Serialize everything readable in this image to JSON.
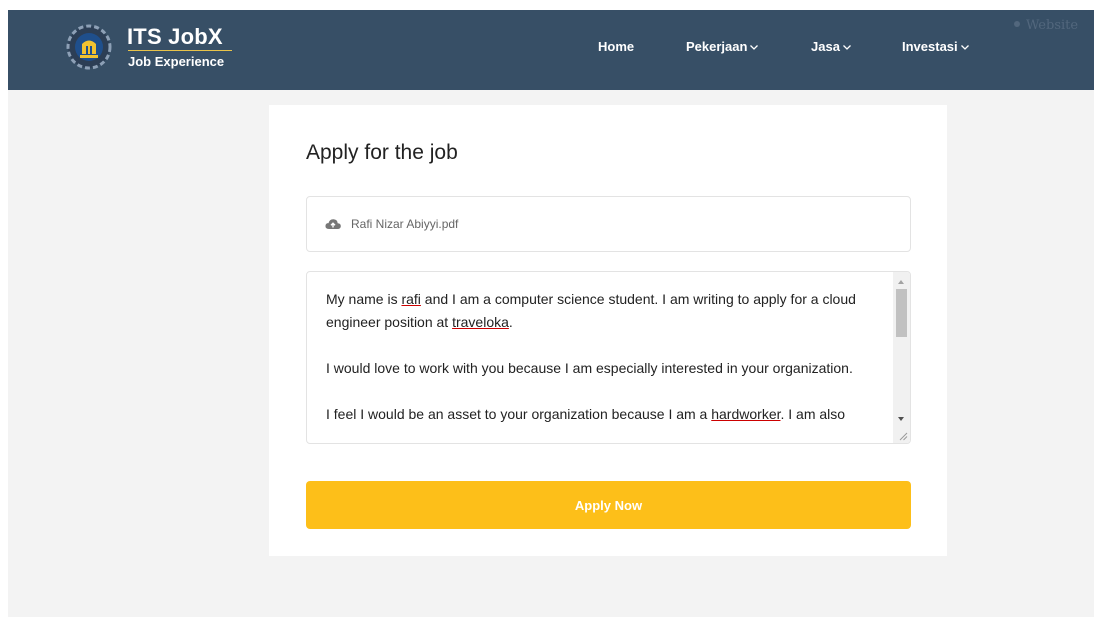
{
  "navbar": {
    "brand_title": "ITS JobX",
    "brand_subtitle": "Job Experience",
    "items": [
      {
        "label": "Home",
        "has_dropdown": false
      },
      {
        "label": "Pekerjaan",
        "has_dropdown": true
      },
      {
        "label": "Jasa",
        "has_dropdown": true
      },
      {
        "label": "Investasi",
        "has_dropdown": true
      }
    ],
    "external_link": "Website",
    "background_color": "#374f66"
  },
  "form": {
    "title": "Apply for the job",
    "attachment": {
      "icon": "cloud-upload-icon",
      "file_name": "Rafi Nizar Abiyyi.pdf"
    },
    "cover_letter": {
      "paragraphs": [
        "My name is rafi and I am a computer science student. I am writing to apply for a cloud engineer position at traveloka.",
        "I would love to work with you because I am especially interested in your organization.",
        "I feel I would be an asset to your organization because I am a hardworker. I am also"
      ],
      "misspelled_words": [
        "rafi",
        "traveloka",
        "hardworker"
      ]
    },
    "submit_label": "Apply Now",
    "submit_color": "#fdbf19"
  }
}
